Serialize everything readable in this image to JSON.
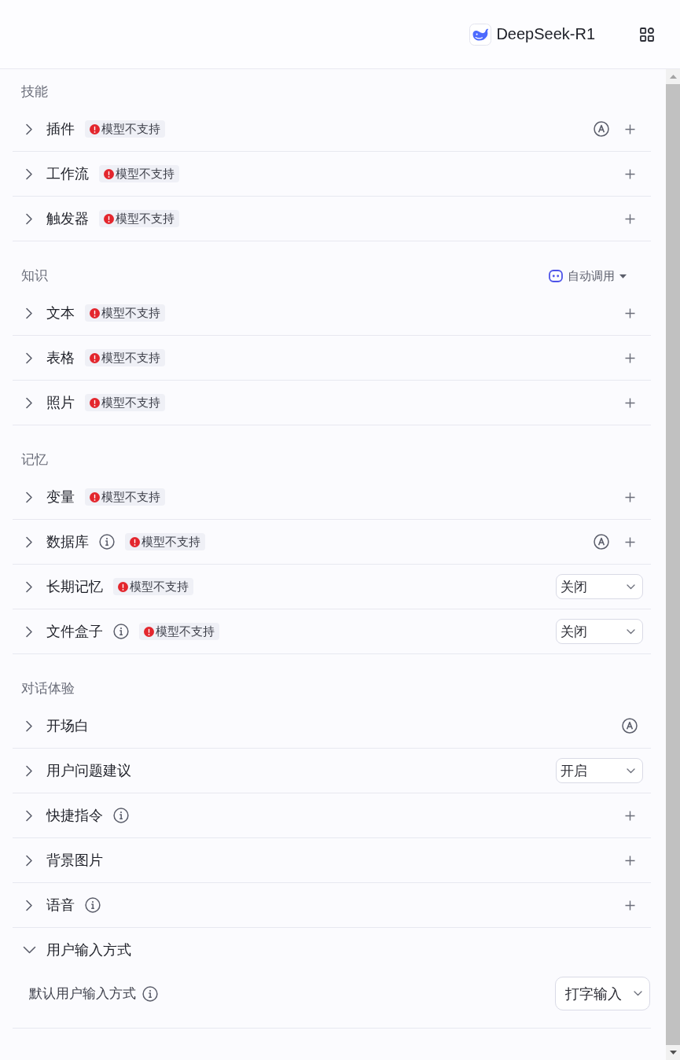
{
  "header": {
    "model": "DeepSeek-R1"
  },
  "sections": [
    {
      "title": "技能",
      "items": [
        {
          "label": "插件",
          "expanded": false,
          "info": false,
          "badge": "模型不支持",
          "auto": true,
          "control": {
            "kind": "add"
          }
        },
        {
          "label": "工作流",
          "expanded": false,
          "info": false,
          "badge": "模型不支持",
          "auto": false,
          "control": {
            "kind": "add"
          }
        },
        {
          "label": "触发器",
          "expanded": false,
          "info": false,
          "badge": "模型不支持",
          "auto": false,
          "control": {
            "kind": "add"
          }
        }
      ]
    },
    {
      "title": "知识",
      "call_mode": "自动调用",
      "items": [
        {
          "label": "文本",
          "expanded": false,
          "info": false,
          "badge": "模型不支持",
          "auto": false,
          "control": {
            "kind": "add"
          }
        },
        {
          "label": "表格",
          "expanded": false,
          "info": false,
          "badge": "模型不支持",
          "auto": false,
          "control": {
            "kind": "add"
          }
        },
        {
          "label": "照片",
          "expanded": false,
          "info": false,
          "badge": "模型不支持",
          "auto": false,
          "control": {
            "kind": "add"
          }
        }
      ]
    },
    {
      "title": "记忆",
      "items": [
        {
          "label": "变量",
          "expanded": false,
          "info": false,
          "badge": "模型不支持",
          "auto": false,
          "control": {
            "kind": "add"
          }
        },
        {
          "label": "数据库",
          "expanded": false,
          "info": true,
          "badge": "模型不支持",
          "auto": true,
          "control": {
            "kind": "add"
          }
        },
        {
          "label": "长期记忆",
          "expanded": false,
          "info": false,
          "badge": "模型不支持",
          "auto": false,
          "control": {
            "kind": "select",
            "value": "关闭"
          }
        },
        {
          "label": "文件盒子",
          "expanded": false,
          "info": true,
          "badge": "模型不支持",
          "auto": false,
          "control": {
            "kind": "select",
            "value": "关闭"
          }
        }
      ]
    },
    {
      "title": "对话体验",
      "items": [
        {
          "label": "开场白",
          "expanded": false,
          "info": false,
          "auto": true
        },
        {
          "label": "用户问题建议",
          "expanded": false,
          "info": false,
          "auto": false,
          "control": {
            "kind": "select",
            "value": "开启"
          }
        },
        {
          "label": "快捷指令",
          "expanded": false,
          "info": true,
          "auto": false,
          "control": {
            "kind": "add"
          }
        },
        {
          "label": "背景图片",
          "expanded": false,
          "info": false,
          "auto": false,
          "control": {
            "kind": "add"
          }
        },
        {
          "label": "语音",
          "expanded": false,
          "info": true,
          "auto": false,
          "control": {
            "kind": "add"
          }
        },
        {
          "label": "用户输入方式",
          "expanded": true,
          "info": false,
          "auto": false,
          "settings": [
            {
              "label": "默认用户输入方式",
              "info": true,
              "control": {
                "kind": "select",
                "value": "打字输入"
              }
            }
          ]
        }
      ]
    }
  ]
}
